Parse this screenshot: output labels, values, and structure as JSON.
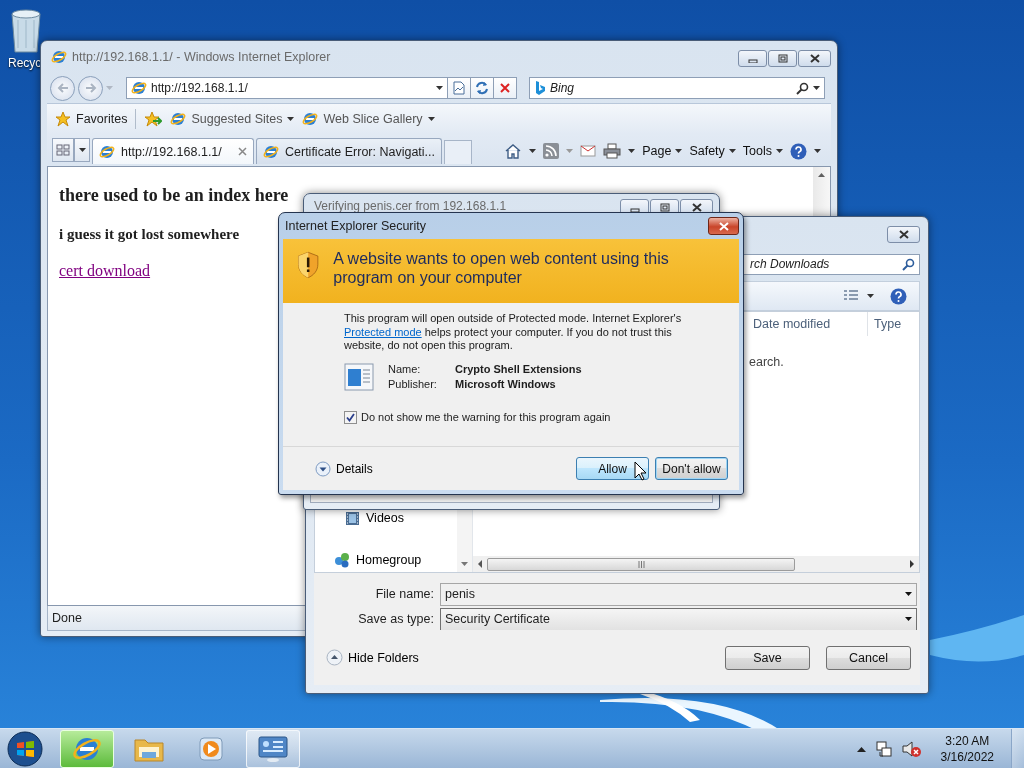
{
  "desktop": {
    "icons": [
      {
        "label": "Recyc"
      }
    ]
  },
  "ie_window": {
    "title": "http://192.168.1.1/ - Windows Internet Explorer",
    "address": "http://192.168.1.1/",
    "search": {
      "placeholder": "Bing"
    },
    "favorites_bar": {
      "favorites": "Favorites",
      "links": [
        {
          "label": "Suggested Sites"
        },
        {
          "label": "Web Slice Gallery"
        }
      ]
    },
    "tabs": [
      {
        "label": "http://192.168.1.1/",
        "selected": true
      },
      {
        "label": "Certificate Error: Navigati...",
        "selected": false
      }
    ],
    "command_bar": [
      "Page",
      "Safety",
      "Tools"
    ],
    "page": {
      "heading": "there used to be an index here",
      "subheading": "i guess it got lost somewhere",
      "link": {
        "label": "cert download",
        "visited": true
      }
    },
    "status_bar": "Done"
  },
  "save_dialog": {
    "search": {
      "placeholder": "rch Downloads"
    },
    "columns": [
      "Date modified",
      "Type"
    ],
    "empty_note": "earch.",
    "nav_items": [
      {
        "label": "Videos",
        "kind": "videos"
      },
      {
        "label": "Homegroup",
        "kind": "homegroup"
      }
    ],
    "file_name": {
      "label": "File name:",
      "value": "penis"
    },
    "save_as_type": {
      "label": "Save as type:",
      "value": "Security Certificate"
    },
    "hide_folders": "Hide Folders",
    "buttons": [
      "Save",
      "Cancel"
    ]
  },
  "verify_window": {
    "title": "Verifying penis.cer from 192.168.1.1"
  },
  "security_dialog": {
    "title": "Internet Explorer Security",
    "heading": "A website wants to open web content using this program on your computer",
    "message": {
      "before": "This program will open outside of Protected mode. Internet Explorer's",
      "link": "Protected mode",
      "after": "helps protect your computer. If you do not trust this website, do not open this program."
    },
    "fields": [
      {
        "label": "Name:",
        "value": "Crypto Shell Extensions"
      },
      {
        "label": "Publisher:",
        "value": "Microsoft Windows"
      }
    ],
    "remember": {
      "label": "Do not show me the warning for this program again",
      "checked": true
    },
    "details": "Details",
    "buttons": [
      {
        "label": "Allow",
        "hovered": true
      },
      {
        "label": "Don't allow",
        "hovered": false
      }
    ]
  },
  "taskbar": {
    "apps": [
      {
        "kind": "browser",
        "running": true,
        "hovered": true
      },
      {
        "kind": "explorer",
        "running": false,
        "hovered": false
      },
      {
        "kind": "media",
        "running": false,
        "hovered": false
      },
      {
        "kind": "control",
        "running": true,
        "hovered": false
      }
    ],
    "clock": {
      "time": "3:20 AM",
      "date": "3/16/2022"
    }
  }
}
